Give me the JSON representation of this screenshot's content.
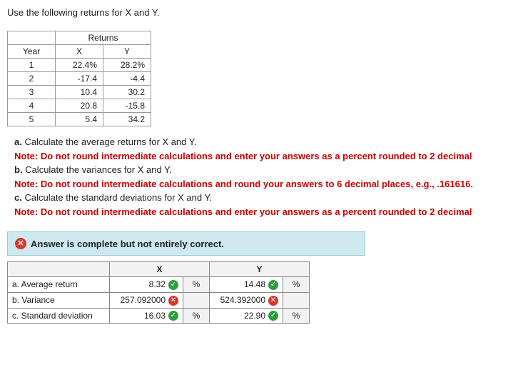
{
  "prompt": "Use the following returns for X and Y.",
  "returns_table": {
    "header_returns": "Returns",
    "cols": [
      "Year",
      "X",
      "Y"
    ],
    "rows": [
      {
        "year": "1",
        "x": "22.4%",
        "y": "28.2%"
      },
      {
        "year": "2",
        "x": "-17.4",
        "y": "-4.4"
      },
      {
        "year": "3",
        "x": "10.4",
        "y": "30.2"
      },
      {
        "year": "4",
        "x": "20.8",
        "y": "-15.8"
      },
      {
        "year": "5",
        "x": "5.4",
        "y": "34.2"
      }
    ]
  },
  "questions": {
    "a_label": "a.",
    "a_text": "Calculate the average returns for X and Y.",
    "a_note": "Note: Do not round intermediate calculations and enter your answers as a percent rounded to 2 decimal",
    "b_label": "b.",
    "b_text": "Calculate the variances for X and Y.",
    "b_note": "Note: Do not round intermediate calculations and round your answers to 6 decimal places, e.g., .161616.",
    "c_label": "c.",
    "c_text": "Calculate the standard deviations for X and Y.",
    "c_note": "Note: Do not round intermediate calculations and enter your answers as a percent rounded to 2 decimal"
  },
  "banner": "Answer is complete but not entirely correct.",
  "answers_table": {
    "col_x": "X",
    "col_y": "Y",
    "rows": {
      "a": {
        "label": "a. Average return",
        "x": "8.32",
        "x_ok": true,
        "x_unit": "%",
        "y": "14.48",
        "y_ok": true,
        "y_unit": "%"
      },
      "b": {
        "label": "b. Variance",
        "x": "257.092000",
        "x_ok": false,
        "x_unit": "",
        "y": "524.392000",
        "y_ok": false,
        "y_unit": ""
      },
      "c": {
        "label": "c. Standard deviation",
        "x": "16.03",
        "x_ok": true,
        "x_unit": "%",
        "y": "22.90",
        "y_ok": true,
        "y_unit": "%"
      }
    }
  },
  "chart_data": {
    "type": "table",
    "title": "Returns for X and Y",
    "categories": [
      "1",
      "2",
      "3",
      "4",
      "5"
    ],
    "series": [
      {
        "name": "X",
        "values": [
          22.4,
          -17.4,
          10.4,
          20.8,
          5.4
        ]
      },
      {
        "name": "Y",
        "values": [
          28.2,
          -4.4,
          30.2,
          -15.8,
          34.2
        ]
      }
    ]
  }
}
